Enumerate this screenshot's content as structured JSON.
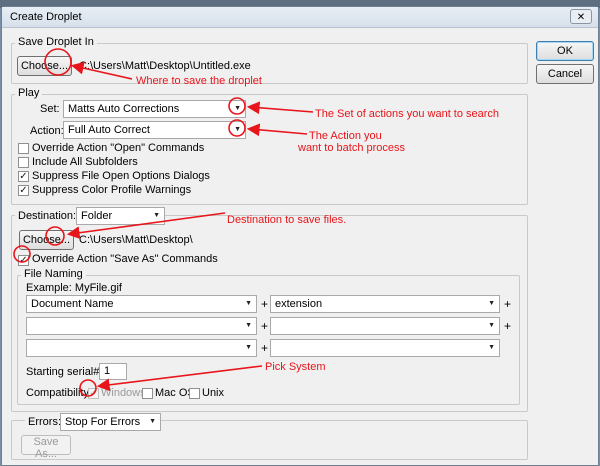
{
  "window": {
    "title": "Create Droplet",
    "close_glyph": "✕"
  },
  "buttons": {
    "ok": "OK",
    "cancel": "Cancel",
    "choose": "Choose...",
    "save_as": "Save As..."
  },
  "save_droplet": {
    "legend": "Save Droplet In",
    "path": "C:\\Users\\Matt\\Desktop\\Untitled.exe"
  },
  "play": {
    "legend": "Play",
    "set_label": "Set:",
    "set_value": "Matts Auto Corrections",
    "action_label": "Action:",
    "action_value": "Full Auto Correct",
    "checkboxes": [
      {
        "label": "Override Action \"Open\" Commands",
        "checked": false
      },
      {
        "label": "Include All Subfolders",
        "checked": false
      },
      {
        "label": "Suppress File Open Options Dialogs",
        "checked": true
      },
      {
        "label": "Suppress Color Profile Warnings",
        "checked": true
      }
    ]
  },
  "destination": {
    "label": "Destination:",
    "value": "Folder",
    "path": "C:\\Users\\Matt\\Desktop\\",
    "override_label": "Override Action \"Save As\" Commands",
    "override_checked": true
  },
  "file_naming": {
    "legend": "File Naming",
    "example": "Example: MyFile.gif",
    "rows": [
      {
        "left": "Document Name",
        "right": "extension"
      },
      {
        "left": "",
        "right": ""
      },
      {
        "left": "",
        "right": ""
      }
    ],
    "plus": "+",
    "serial_label": "Starting serial#:",
    "serial_value": "1",
    "compat_label": "Compatibility:",
    "compat_windows": "Windows",
    "compat_macos": "Mac OS",
    "compat_unix": "Unix"
  },
  "errors": {
    "label": "Errors:",
    "value": "Stop For Errors"
  },
  "annotations": {
    "where_save": "Where to save the droplet",
    "set_actions": "The Set of actions you want to search",
    "action_line1": "The Action you",
    "action_line2": "want to batch process",
    "destination": "Destination to save files.",
    "pick_system": "Pick System"
  },
  "colors": {
    "annotation": "#e8151b",
    "window_bg": "#f0f0f0",
    "default_button_border": "#3c7fb1"
  },
  "icons": {
    "dropdown": "chevron-down-icon",
    "check": "checkmark-icon"
  }
}
